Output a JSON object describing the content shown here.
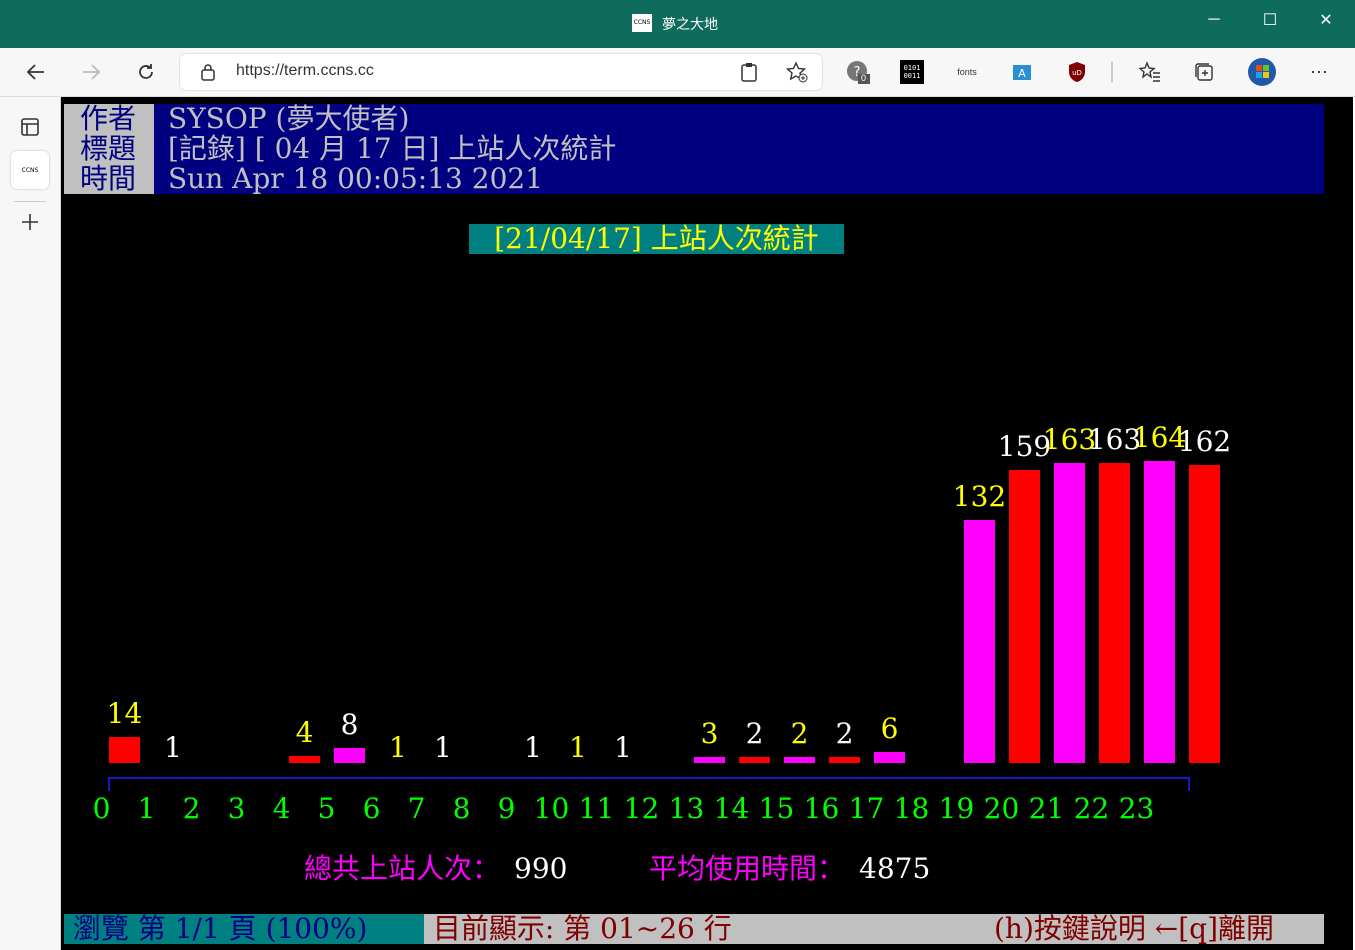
{
  "window": {
    "title": "夢之大地",
    "favicon_text": "CCNS",
    "min_icon": "─",
    "max_icon": "☐",
    "close_icon": "✕"
  },
  "browser": {
    "url": "https://term.ccns.cc",
    "ext_bits": "0101\n0011",
    "ext_fonts": "fonts",
    "ext_badge": "0"
  },
  "post": {
    "author_label": "作者",
    "author_value": "SYSOP (夢大使者)",
    "title_label": "標題",
    "title_value": "[記錄] [ 04 月 17 日] 上站人次統計",
    "time_label": "時間",
    "time_value": "Sun Apr 18 00:05:13 2021"
  },
  "banner": "[21/04/17] 上站人次統計",
  "chart_data": {
    "type": "bar",
    "title": "[21/04/17] 上站人次統計",
    "categories": [
      "0",
      "1",
      "2",
      "3",
      "4",
      "5",
      "6",
      "7",
      "8",
      "9",
      "10",
      "11",
      "12",
      "13",
      "14",
      "15",
      "16",
      "17",
      "18",
      "19",
      "20",
      "21",
      "22",
      "23"
    ],
    "values": [
      14,
      1,
      0,
      0,
      4,
      8,
      1,
      1,
      0,
      1,
      1,
      1,
      0,
      3,
      2,
      2,
      2,
      6,
      0,
      132,
      159,
      163,
      163,
      164,
      162
    ],
    "value_labels": [
      "14",
      "1",
      "",
      "",
      "4",
      "8",
      "1",
      "1",
      "",
      "1",
      "1",
      "1",
      "",
      "3",
      "2",
      "2",
      "2",
      "6",
      "",
      "132",
      "159",
      "163",
      "163",
      "164",
      "162"
    ],
    "label_colors": [
      "#ffff00",
      "#ffffff",
      "",
      "",
      "#ffff00",
      "#ffffff",
      "#ffff00",
      "#ffffff",
      "",
      "#ffffff",
      "#ffff00",
      "#ffffff",
      "",
      "#ffff00",
      "#ffffff",
      "#ffff00",
      "#ffffff",
      "#ffff00",
      "",
      "#ffff00",
      "#ffffff",
      "#ffff00",
      "#ffffff",
      "#ffff00",
      "#ffffff"
    ],
    "bar_colors": [
      "#ff0000",
      "#ff00ff"
    ],
    "axis_color": "#00ff00",
    "ylim": [
      0,
      170
    ]
  },
  "summary": {
    "total_label": "總共上站人次：",
    "total_value": "990",
    "avg_label": "平均使用時間：",
    "avg_value": "4875"
  },
  "status": {
    "browse": " 瀏覽 第 1/1 頁 (100%) ",
    "display": " 目前顯示: 第 01~26 行",
    "help": "(h)按鍵說明 ←[q]離開 "
  }
}
